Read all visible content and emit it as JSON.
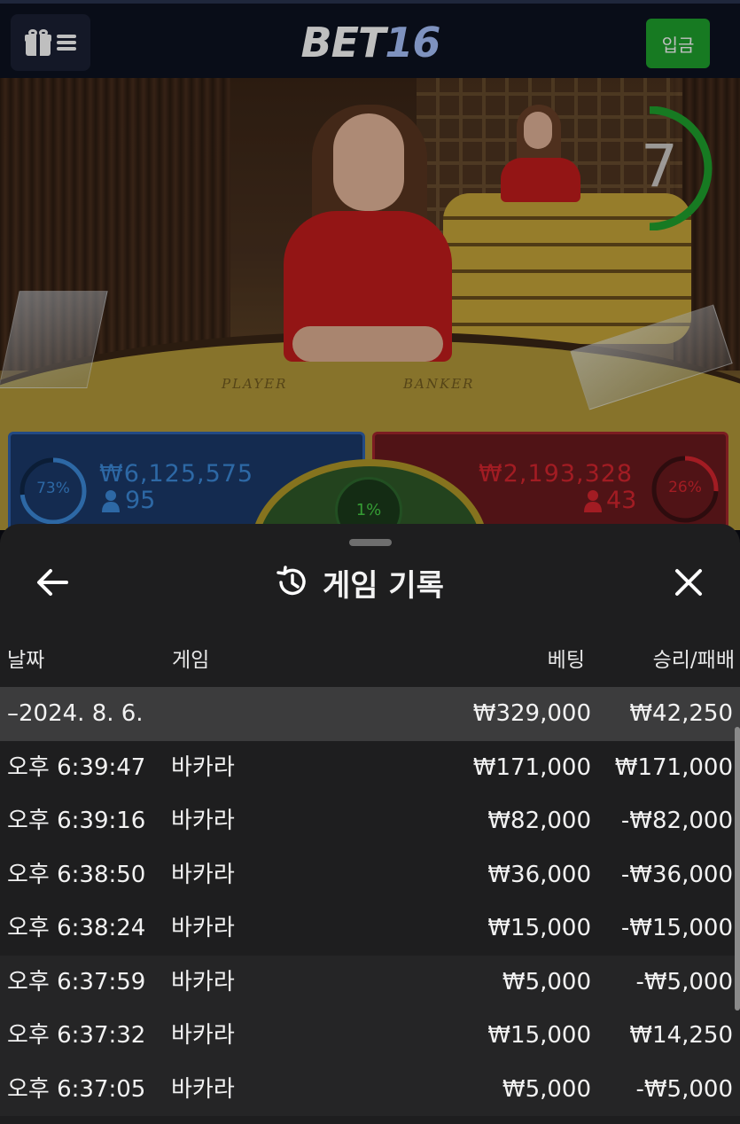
{
  "header": {
    "logo_part1": "BET",
    "logo_part2": "16",
    "deposit_label": "입금"
  },
  "video": {
    "countdown": "7",
    "table_player_label": "PLAYER",
    "table_banker_label": "BANKER"
  },
  "betting": {
    "player": {
      "amount": "₩6,125,575",
      "count": "95",
      "percent": "73%",
      "color": "#3d8bdc"
    },
    "banker": {
      "amount": "₩2,193,328",
      "count": "43",
      "percent": "26%",
      "color": "#d8262f"
    },
    "tie": {
      "percent": "1%"
    }
  },
  "history": {
    "title": "게임 기록",
    "columns": {
      "date": "날짜",
      "game": "게임",
      "bet": "베팅",
      "result": "승리/패배"
    },
    "summary": {
      "date": "–2024. 8. 6.",
      "bet": "₩329,000",
      "result": "₩42,250"
    },
    "rows": [
      {
        "time": "오후 6:39:47",
        "game": "바카라",
        "bet": "₩171,000",
        "result": "₩171,000"
      },
      {
        "time": "오후 6:39:16",
        "game": "바카라",
        "bet": "₩82,000",
        "result": "-₩82,000"
      },
      {
        "time": "오후 6:38:50",
        "game": "바카라",
        "bet": "₩36,000",
        "result": "-₩36,000"
      },
      {
        "time": "오후 6:38:24",
        "game": "바카라",
        "bet": "₩15,000",
        "result": "-₩15,000"
      },
      {
        "time": "오후 6:37:59",
        "game": "바카라",
        "bet": "₩5,000",
        "result": "-₩5,000"
      },
      {
        "time": "오후 6:37:32",
        "game": "바카라",
        "bet": "₩15,000",
        "result": "₩14,250"
      },
      {
        "time": "오후 6:37:05",
        "game": "바카라",
        "bet": "₩5,000",
        "result": "-₩5,000"
      }
    ]
  },
  "icons": {
    "menu": "gift-icon + hamburger-icon",
    "back": "arrow-left-icon",
    "history": "history-icon",
    "close": "close-icon",
    "user": "user-icon"
  },
  "colors": {
    "deposit": "#1fa32e",
    "player_blue": "#3d8bdc",
    "banker_red": "#d8262f",
    "tie_green": "#47d046",
    "sheet_bg": "#1e1e1f"
  }
}
